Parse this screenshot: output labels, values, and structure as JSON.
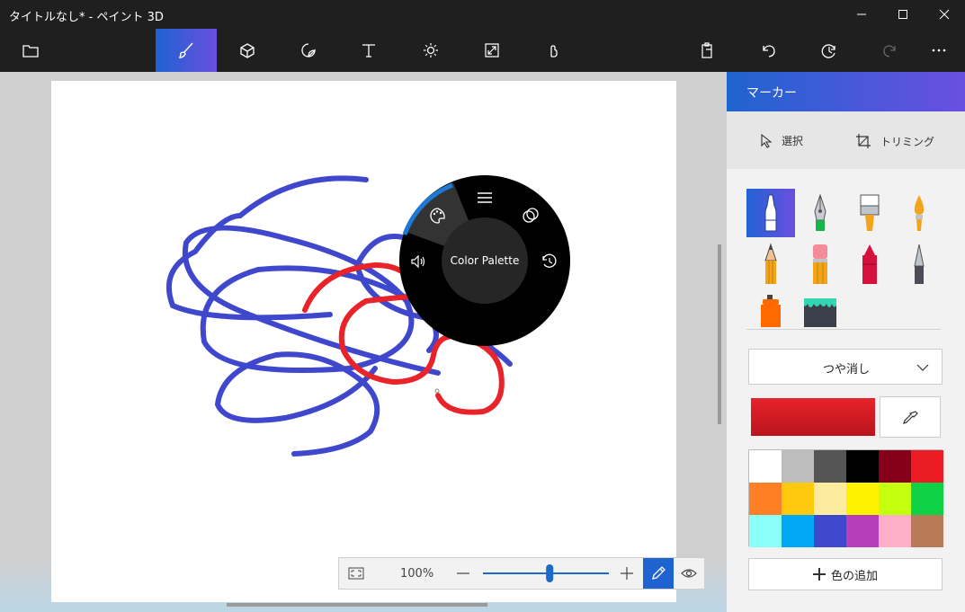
{
  "window": {
    "title": "タイトルなし* - ペイント 3D",
    "controls": [
      "minimize",
      "maximize",
      "close"
    ]
  },
  "toolbar": {
    "left": [
      {
        "name": "open-folder-icon",
        "active": false
      },
      {
        "name": "brushes-icon",
        "active": true
      },
      {
        "name": "3d-shapes-icon",
        "active": false
      },
      {
        "name": "stickers-icon",
        "active": false
      },
      {
        "name": "text-icon",
        "active": false
      },
      {
        "name": "effects-icon",
        "active": false
      },
      {
        "name": "canvas-icon",
        "active": false
      },
      {
        "name": "magic-select-icon",
        "active": false
      }
    ],
    "right": [
      "paste-icon",
      "undo-icon",
      "history-icon",
      "redo-icon",
      "more-icon"
    ]
  },
  "radial_menu": {
    "center_label": "Color Palette"
  },
  "zoom": {
    "percent": "100%",
    "level": 0.53
  },
  "panel": {
    "title": "マーカー",
    "select_label": "選択",
    "crop_label": "トリミング",
    "finish_label": "つや消し",
    "add_color_label": "色の追加",
    "current_color": "#e8232a",
    "palette": [
      "#ffffff",
      "#bdbdbd",
      "#555555",
      "#000000",
      "#86001b",
      "#ec1c24",
      "#ff7f27",
      "#ffc90e",
      "#fdeba0",
      "#fff200",
      "#c4ff0e",
      "#0ed145",
      "#8cfffb",
      "#00a8f3",
      "#3f48cc",
      "#b83dba",
      "#ffaec8",
      "#b97a57"
    ]
  }
}
